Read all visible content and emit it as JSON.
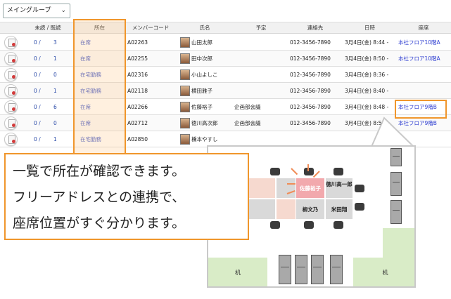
{
  "toolbar": {
    "group_select": "メイングループ"
  },
  "table": {
    "headers": {
      "unread": "未読 / 既読",
      "status": "所在",
      "member_code": "メンバーコード",
      "name": "氏名",
      "schedule": "予定",
      "contact": "連絡先",
      "datetime": "日時",
      "seat": "座席"
    },
    "rows": [
      {
        "unread": "0 /",
        "read": "3",
        "status": "在席",
        "code": "A02263",
        "name": "山田太郎",
        "schedule": "",
        "contact": "012-3456-7890",
        "datetime": "3月4日(金) 8:44 -",
        "seat": "本社フロア10階A"
      },
      {
        "unread": "0 /",
        "read": "1",
        "status": "在席",
        "code": "A02255",
        "name": "田中次郎",
        "schedule": "",
        "contact": "012-3456-7890",
        "datetime": "3月4日(金) 8:50 -",
        "seat": "本社フロア10階A"
      },
      {
        "unread": "0 /",
        "read": "0",
        "status": "在宅勤務",
        "code": "A02316",
        "name": "小山よしこ",
        "schedule": "",
        "contact": "012-3456-7890",
        "datetime": "3月4日(金) 8:36 -",
        "seat": ""
      },
      {
        "unread": "0 /",
        "read": "1",
        "status": "在宅勤務",
        "code": "A02118",
        "name": "横田雅子",
        "schedule": "",
        "contact": "012-3456-7890",
        "datetime": "3月4日(金) 8:40 -",
        "seat": ""
      },
      {
        "unread": "0 /",
        "read": "6",
        "status": "在席",
        "code": "A02266",
        "name": "佐藤裕子",
        "schedule": "企画部会議",
        "contact": "012-3456-7890",
        "datetime": "3月4日(金) 8:48 -",
        "seat": "本社フロア9階B"
      },
      {
        "unread": "0 /",
        "read": "0",
        "status": "在席",
        "code": "A02712",
        "name": "徳川高次郎",
        "schedule": "企画部会議",
        "contact": "012-3456-7890",
        "datetime": "3月4日(金) 8:50 -",
        "seat": "本社フロア9階B"
      },
      {
        "unread": "0 /",
        "read": "1",
        "status": "在宅勤務",
        "code": "A02850",
        "name": "橋本やすし",
        "schedule": "",
        "contact": "",
        "datetime": "",
        "seat": ""
      }
    ]
  },
  "floor_map": {
    "desks": {
      "sato": "佐藤裕子",
      "tokugawa": "徳川高一郎",
      "yanagi": "柳文乃",
      "yoneda": "米田翔"
    },
    "zone_left": "机",
    "zone_right": "机"
  },
  "caption": {
    "line1": "一覧で所在が確認できます。",
    "line2": "フリーアドレスとの連携で、",
    "line3": "座席位置がすぐ分かります。"
  },
  "colors": {
    "accent": "#f0962c",
    "link": "#2b3bd0",
    "highlight_desk": "#f2a9ad"
  }
}
